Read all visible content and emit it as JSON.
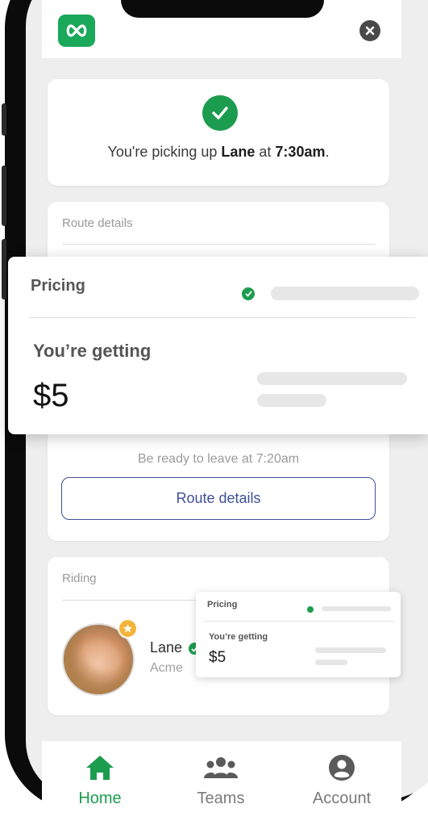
{
  "confirmation": {
    "prefix": "You're picking up ",
    "rider": "Lane",
    "middle": " at ",
    "time": "7:30am",
    "suffix": "."
  },
  "route_card": {
    "section_label": "Route details",
    "ready_text": "Be ready to leave at 7:20am",
    "button_label": "Route details"
  },
  "riding_card": {
    "section_label": "Riding",
    "rider_name": "Lane",
    "rider_company": "Acme"
  },
  "pricing_popup": {
    "title": "Pricing",
    "getting_label": "You’re getting",
    "price": "$5"
  },
  "mini_pricing": {
    "title": "Pricing",
    "getting_label": "You’re getting",
    "price": "$5"
  },
  "nav": {
    "home": "Home",
    "teams": "Teams",
    "account": "Account"
  },
  "colors": {
    "brand_green": "#1aa85a",
    "accent_blue": "#3f4f9a"
  },
  "icons": [
    "app-logo-icon",
    "close-icon",
    "checkmark-icon",
    "verified-icon",
    "star-icon",
    "home-icon",
    "teams-icon",
    "account-icon"
  ]
}
